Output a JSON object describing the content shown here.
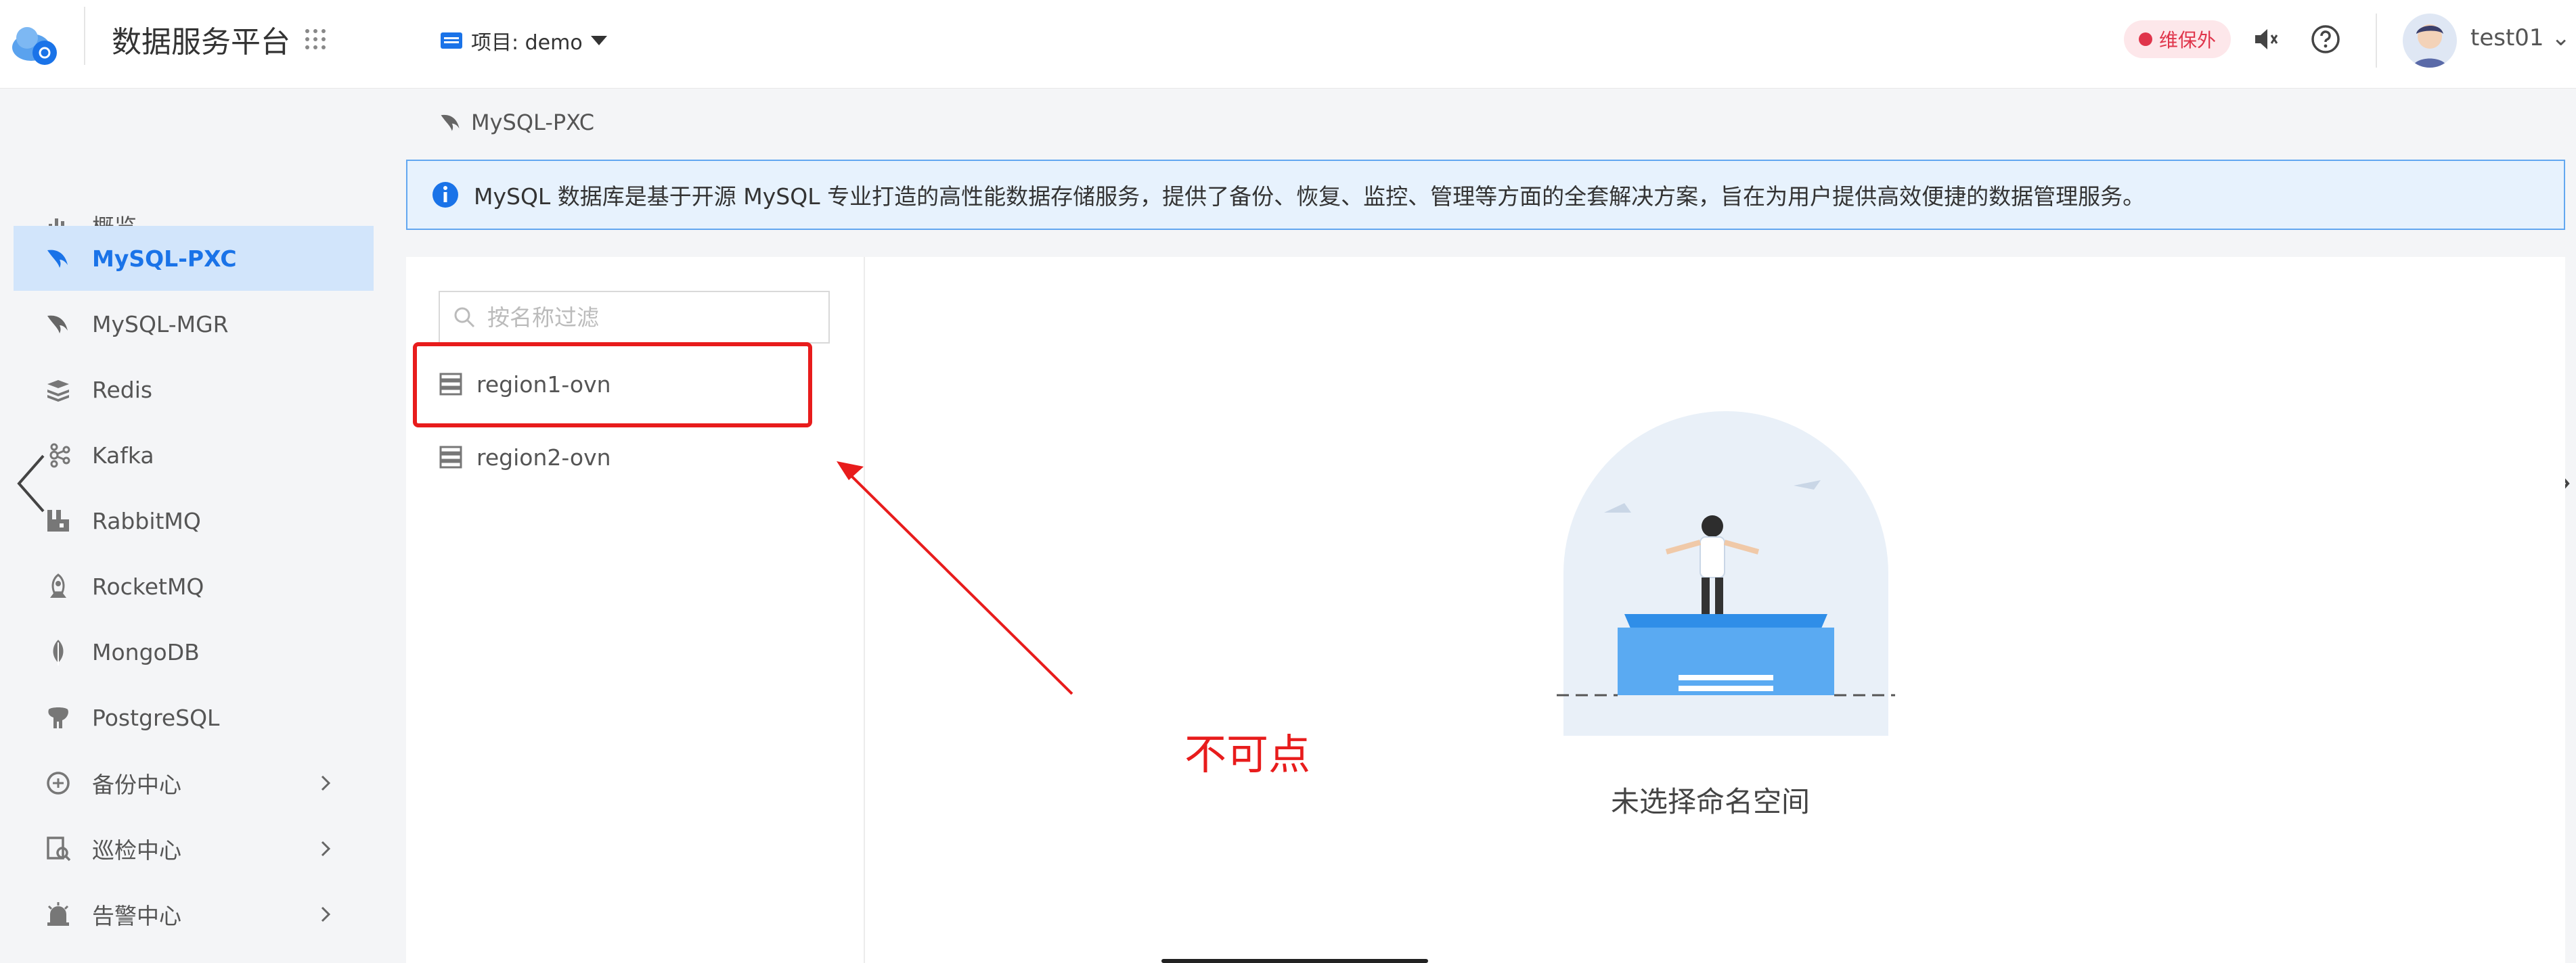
{
  "header": {
    "app_title": "数据服务平台",
    "project_label": "项目: demo",
    "maintenance_badge": "维保外",
    "username": "test01",
    "username_suffix": "⌄"
  },
  "sidebar": {
    "items": [
      {
        "label": "概览",
        "icon": "chart-icon",
        "active": false
      },
      {
        "label": "MySQL-PXC",
        "icon": "dolphin-icon",
        "active": true
      },
      {
        "label": "MySQL-MGR",
        "icon": "dolphin-icon",
        "active": false
      },
      {
        "label": "Redis",
        "icon": "redis-icon",
        "active": false
      },
      {
        "label": "Kafka",
        "icon": "kafka-icon",
        "active": false
      },
      {
        "label": "RabbitMQ",
        "icon": "rabbitmq-icon",
        "active": false
      },
      {
        "label": "RocketMQ",
        "icon": "rocket-icon",
        "active": false
      },
      {
        "label": "MongoDB",
        "icon": "leaf-icon",
        "active": false
      },
      {
        "label": "PostgreSQL",
        "icon": "elephant-icon",
        "active": false
      },
      {
        "label": "备份中心",
        "icon": "backup-icon",
        "active": false,
        "expandable": true
      },
      {
        "label": "巡检中心",
        "icon": "inspection-icon",
        "active": false,
        "expandable": true
      },
      {
        "label": "告警中心",
        "icon": "alarm-icon",
        "active": false,
        "expandable": true
      }
    ]
  },
  "main": {
    "breadcrumb": "MySQL-PXC",
    "info": "MySQL 数据库是基于开源 MySQL 专业打造的高性能数据存储服务，提供了备份、恢复、监控、管理等方面的全套解决方案，旨在为用户提供高效便捷的数据管理服务。",
    "filter_placeholder": "按名称过滤",
    "namespaces": [
      "region1-ovn",
      "region2-ovn"
    ],
    "annotation": "不可点",
    "empty_text": "未选择命名空间"
  },
  "colors": {
    "accent": "#1a73e8",
    "active_bg": "#d2e5fb",
    "annotation_red": "#e81c1c",
    "badge_red": "#e0354b"
  }
}
